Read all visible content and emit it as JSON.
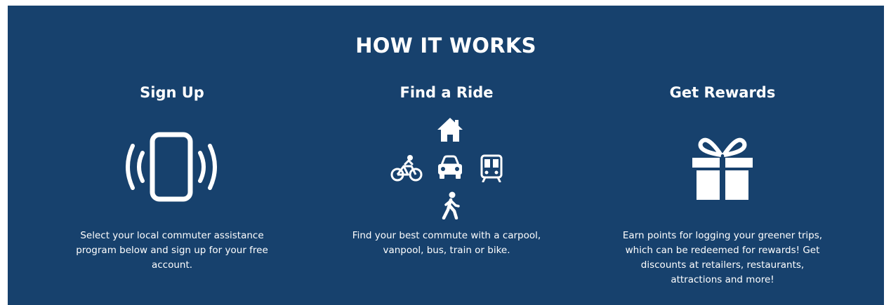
{
  "section": {
    "title": "HOW IT WORKS"
  },
  "steps": [
    {
      "title": "Sign Up",
      "description": "Select your local commuter assistance program below and sign up for your free account.",
      "icon": "smartphone-vibrating-icon"
    },
    {
      "title": "Find a Ride",
      "description": "Find your best commute with a carpool, vanpool, bus, train or bike.",
      "icons": [
        "home-icon",
        "bicycle-icon",
        "car-icon",
        "train-icon",
        "walking-person-icon"
      ]
    },
    {
      "title": "Get Rewards",
      "description": "Earn points for logging your greener trips, which can be redeemed for rewards! Get discounts at retailers, restaurants, attractions and more!",
      "icon": "gift-icon"
    }
  ],
  "colors": {
    "background": "#17416d",
    "text": "#ffffff"
  }
}
